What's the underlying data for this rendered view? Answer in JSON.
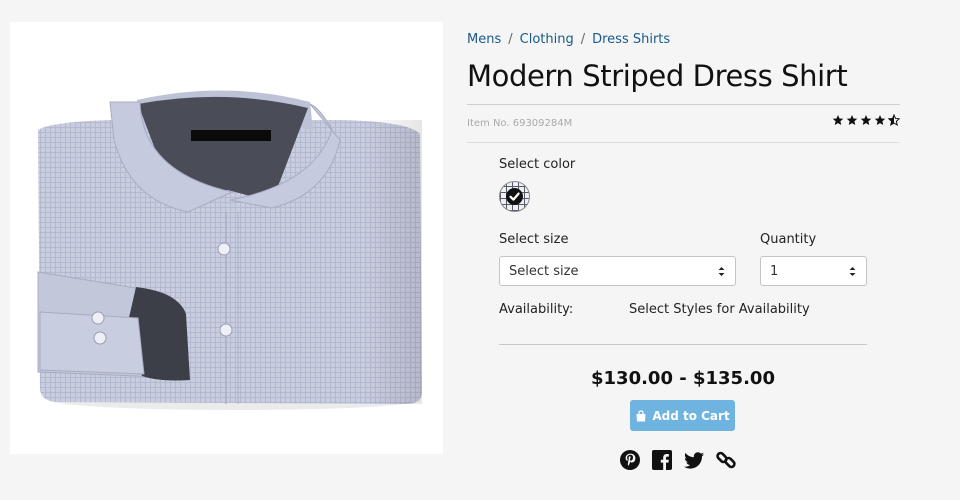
{
  "breadcrumb": {
    "items": [
      {
        "label": "Mens"
      },
      {
        "label": "Clothing"
      },
      {
        "label": "Dress Shirts"
      }
    ],
    "separator": "/"
  },
  "product": {
    "title": "Modern Striped Dress Shirt",
    "item_number": "Item No. 69309284M",
    "rating": 4.5,
    "rating_max": 5,
    "image_icon": "folded-striped-dress-shirt"
  },
  "options": {
    "color_label": "Select color",
    "color_swatch_selected": true,
    "size_label": "Select size",
    "size_value": "Select size",
    "quantity_label": "Quantity",
    "quantity_value": "1",
    "availability_label": "Availability:",
    "availability_value": "Select Styles for Availability"
  },
  "pricing": {
    "price_range": "$130.00 - $135.00"
  },
  "cart": {
    "label": "Add to Cart",
    "icon": "shopping-bag-icon"
  },
  "share": [
    "pinterest-icon",
    "facebook-icon",
    "twitter-icon",
    "link-icon"
  ],
  "colors": {
    "link": "#1a5a8a",
    "button": "#6fb3e0",
    "background": "#f5f5f5"
  }
}
